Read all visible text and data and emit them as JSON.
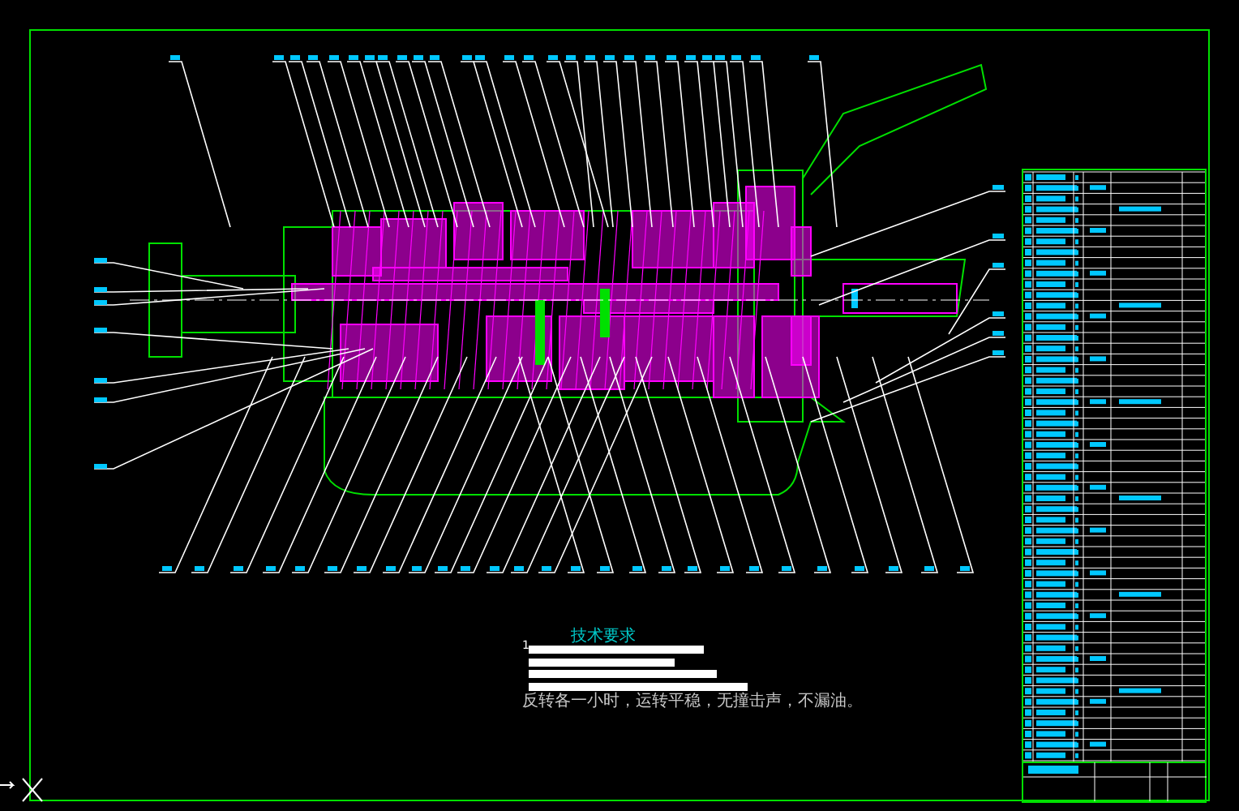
{
  "notes": {
    "title": "技术要求",
    "line_marker": "1",
    "last_line": "反转各一小时，运转平稳，无撞击声，不漏油。"
  }
}
